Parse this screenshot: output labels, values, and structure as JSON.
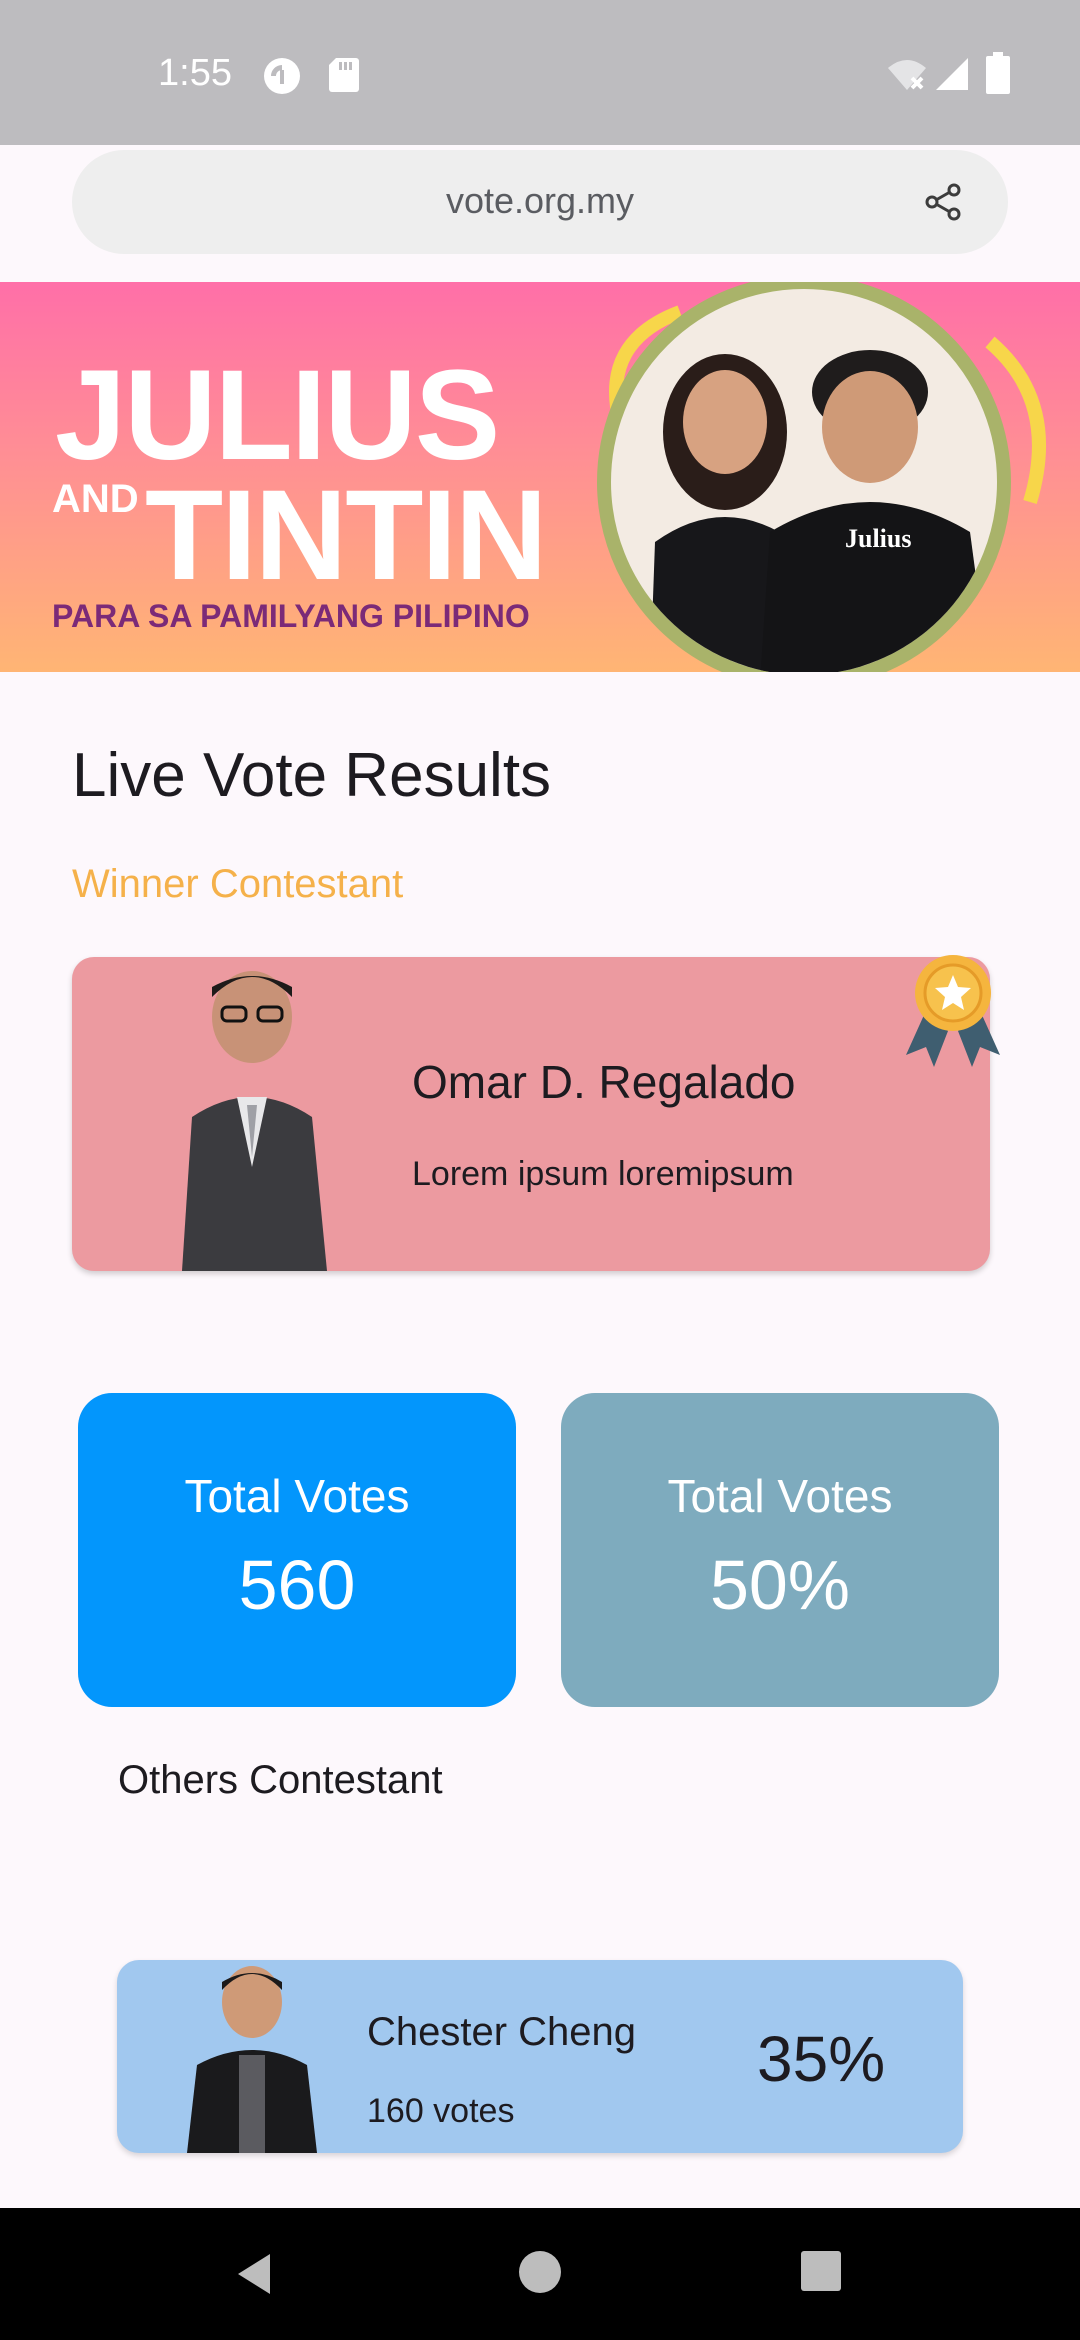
{
  "status_bar": {
    "time": "1:55"
  },
  "browser": {
    "url": "vote.org.my"
  },
  "banner": {
    "line1": "JULIUS",
    "and": "AND",
    "line2": "TINTIN",
    "tagline": "PARA SA PAMILYANG PILIPINO",
    "shirt_text": "Julius"
  },
  "page": {
    "title": "Live Vote Results",
    "winner_label": "Winner Contestant",
    "others_label": "Others Contestant"
  },
  "winner": {
    "name": "Omar D. Regalado",
    "description": "Lorem ipsum loremipsum"
  },
  "stats": [
    {
      "label": "Total Votes",
      "value": "560"
    },
    {
      "label": "Total Votes",
      "value": "50%"
    }
  ],
  "others": [
    {
      "name": "Chester Cheng",
      "votes": "160 votes",
      "percent": "35%"
    }
  ],
  "colors": {
    "accent_gold": "#f5b14a",
    "winner_card": "#ec9aa0",
    "stat_blue": "#0396fc",
    "stat_teal": "#7eabbe",
    "other_card": "#a1c8ef"
  },
  "icons": [
    "pocket-casts-icon",
    "sd-card-icon",
    "wifi-off-icon",
    "signal-icon",
    "battery-icon",
    "share-icon",
    "medal-icon",
    "back-icon",
    "home-icon",
    "recents-icon"
  ]
}
